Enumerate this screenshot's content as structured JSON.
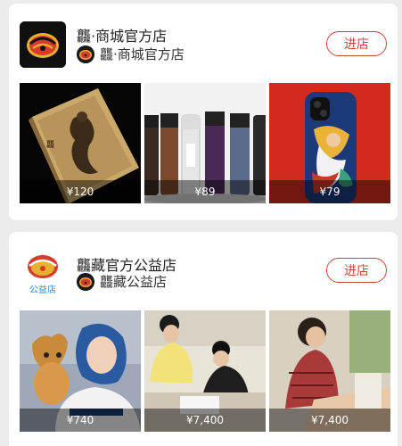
{
  "shops": [
    {
      "name": "龘·商城官方店",
      "sub_name": "龘·商城官方店",
      "enter_label": "进店",
      "products": [
        {
          "price": "¥120",
          "subject": "book"
        },
        {
          "price": "¥89",
          "subject": "bottles"
        },
        {
          "price": "¥79",
          "subject": "phone-case"
        }
      ]
    },
    {
      "name": "龘藏官方公益店",
      "sub_name": "龘藏公益店",
      "logo_caption": "公益店",
      "enter_label": "进店",
      "products": [
        {
          "price": "¥740",
          "subject": "person-with-plush"
        },
        {
          "price": "¥7,400",
          "subject": "people-at-table"
        },
        {
          "price": "¥7,400",
          "subject": "person-drawing"
        }
      ]
    }
  ],
  "colors": {
    "accent": "#c8463b",
    "background": "#ececec",
    "card": "#ffffff"
  }
}
